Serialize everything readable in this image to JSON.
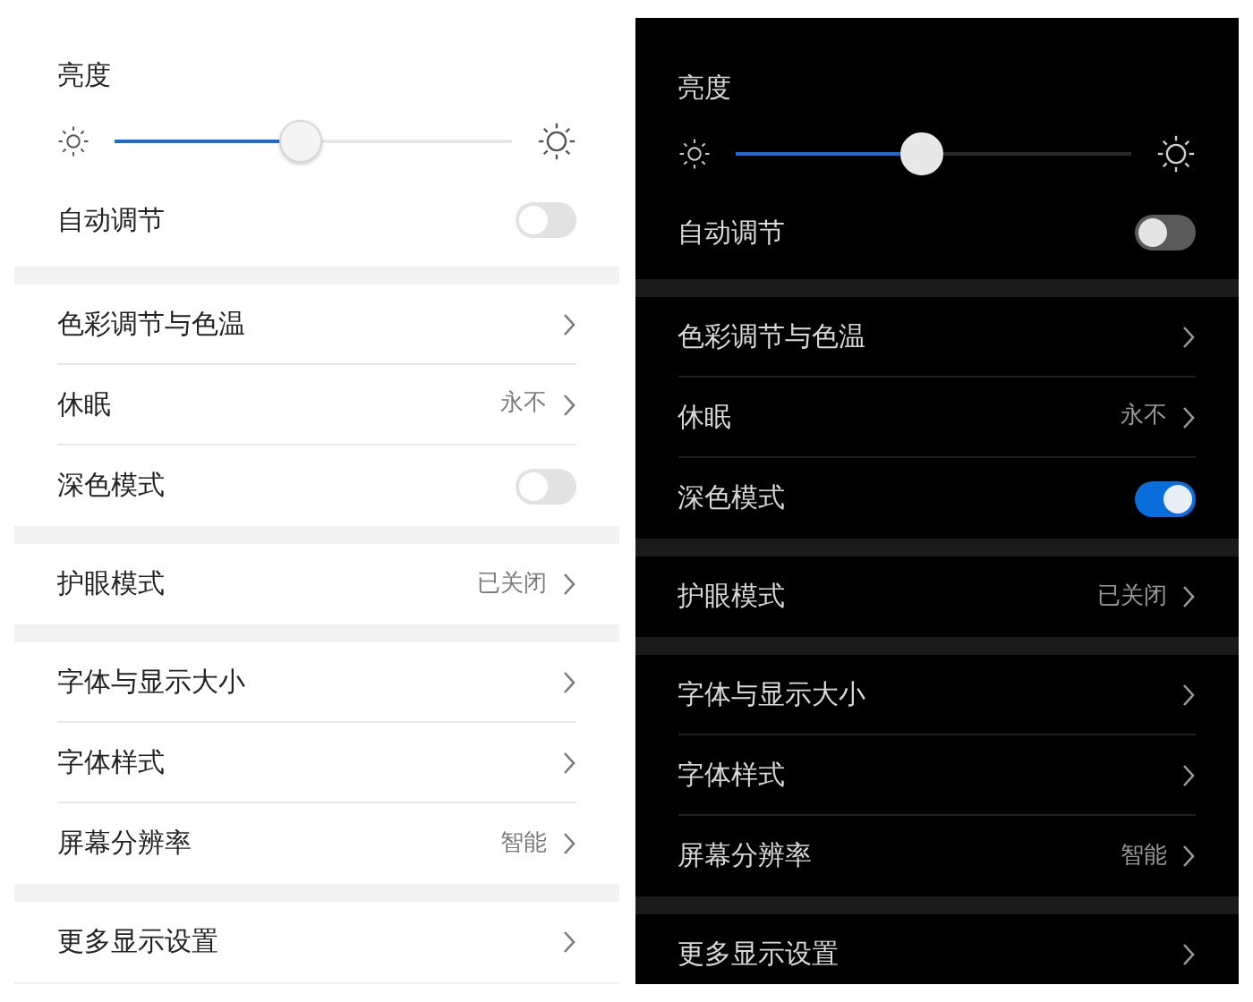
{
  "screens": [
    {
      "dark": false,
      "sections": [
        {
          "items": [
            {
              "kind": "heading",
              "label": "亮度"
            },
            {
              "kind": "slider",
              "level": 0.47
            },
            {
              "kind": "toggle",
              "label": "自动调节",
              "on": false
            }
          ]
        },
        {
          "items": [
            {
              "kind": "link",
              "label": "色彩调节与色温"
            },
            {
              "kind": "link",
              "label": "休眠",
              "value": "永不"
            },
            {
              "kind": "toggle",
              "label": "深色模式",
              "on": false
            }
          ]
        },
        {
          "items": [
            {
              "kind": "link",
              "label": "护眼模式",
              "value": "已关闭"
            }
          ]
        },
        {
          "items": [
            {
              "kind": "link",
              "label": "字体与显示大小"
            },
            {
              "kind": "link",
              "label": "字体样式"
            },
            {
              "kind": "link",
              "label": "屏幕分辨率",
              "value": "智能"
            }
          ]
        },
        {
          "items": [
            {
              "kind": "link",
              "label": "更多显示设置"
            }
          ]
        }
      ]
    },
    {
      "dark": true,
      "sections": [
        {
          "items": [
            {
              "kind": "heading",
              "label": "亮度"
            },
            {
              "kind": "slider",
              "level": 0.47
            },
            {
              "kind": "toggle",
              "label": "自动调节",
              "on": false
            }
          ]
        },
        {
          "items": [
            {
              "kind": "link",
              "label": "色彩调节与色温"
            },
            {
              "kind": "link",
              "label": "休眠",
              "value": "永不"
            },
            {
              "kind": "toggle",
              "label": "深色模式",
              "on": true
            }
          ]
        },
        {
          "items": [
            {
              "kind": "link",
              "label": "护眼模式",
              "value": "已关闭"
            }
          ]
        },
        {
          "items": [
            {
              "kind": "link",
              "label": "字体与显示大小"
            },
            {
              "kind": "link",
              "label": "字体样式"
            },
            {
              "kind": "link",
              "label": "屏幕分辨率",
              "value": "智能"
            }
          ]
        },
        {
          "items": [
            {
              "kind": "link",
              "label": "更多显示设置"
            }
          ]
        }
      ]
    }
  ]
}
